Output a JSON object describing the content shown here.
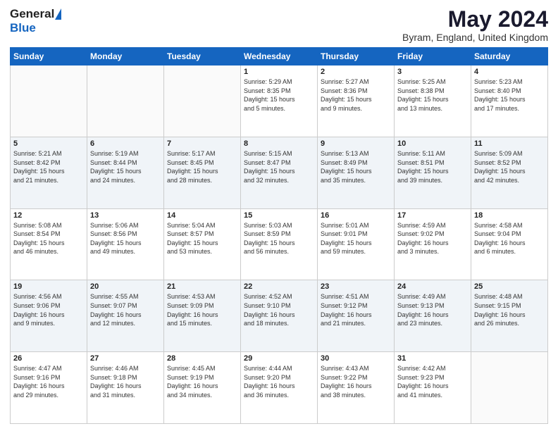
{
  "header": {
    "logo_general": "General",
    "logo_blue": "Blue",
    "month_title": "May 2024",
    "location": "Byram, England, United Kingdom"
  },
  "calendar": {
    "days_of_week": [
      "Sunday",
      "Monday",
      "Tuesday",
      "Wednesday",
      "Thursday",
      "Friday",
      "Saturday"
    ],
    "weeks": [
      [
        {
          "day": "",
          "info": ""
        },
        {
          "day": "",
          "info": ""
        },
        {
          "day": "",
          "info": ""
        },
        {
          "day": "1",
          "info": "Sunrise: 5:29 AM\nSunset: 8:35 PM\nDaylight: 15 hours\nand 5 minutes."
        },
        {
          "day": "2",
          "info": "Sunrise: 5:27 AM\nSunset: 8:36 PM\nDaylight: 15 hours\nand 9 minutes."
        },
        {
          "day": "3",
          "info": "Sunrise: 5:25 AM\nSunset: 8:38 PM\nDaylight: 15 hours\nand 13 minutes."
        },
        {
          "day": "4",
          "info": "Sunrise: 5:23 AM\nSunset: 8:40 PM\nDaylight: 15 hours\nand 17 minutes."
        }
      ],
      [
        {
          "day": "5",
          "info": "Sunrise: 5:21 AM\nSunset: 8:42 PM\nDaylight: 15 hours\nand 21 minutes."
        },
        {
          "day": "6",
          "info": "Sunrise: 5:19 AM\nSunset: 8:44 PM\nDaylight: 15 hours\nand 24 minutes."
        },
        {
          "day": "7",
          "info": "Sunrise: 5:17 AM\nSunset: 8:45 PM\nDaylight: 15 hours\nand 28 minutes."
        },
        {
          "day": "8",
          "info": "Sunrise: 5:15 AM\nSunset: 8:47 PM\nDaylight: 15 hours\nand 32 minutes."
        },
        {
          "day": "9",
          "info": "Sunrise: 5:13 AM\nSunset: 8:49 PM\nDaylight: 15 hours\nand 35 minutes."
        },
        {
          "day": "10",
          "info": "Sunrise: 5:11 AM\nSunset: 8:51 PM\nDaylight: 15 hours\nand 39 minutes."
        },
        {
          "day": "11",
          "info": "Sunrise: 5:09 AM\nSunset: 8:52 PM\nDaylight: 15 hours\nand 42 minutes."
        }
      ],
      [
        {
          "day": "12",
          "info": "Sunrise: 5:08 AM\nSunset: 8:54 PM\nDaylight: 15 hours\nand 46 minutes."
        },
        {
          "day": "13",
          "info": "Sunrise: 5:06 AM\nSunset: 8:56 PM\nDaylight: 15 hours\nand 49 minutes."
        },
        {
          "day": "14",
          "info": "Sunrise: 5:04 AM\nSunset: 8:57 PM\nDaylight: 15 hours\nand 53 minutes."
        },
        {
          "day": "15",
          "info": "Sunrise: 5:03 AM\nSunset: 8:59 PM\nDaylight: 15 hours\nand 56 minutes."
        },
        {
          "day": "16",
          "info": "Sunrise: 5:01 AM\nSunset: 9:01 PM\nDaylight: 15 hours\nand 59 minutes."
        },
        {
          "day": "17",
          "info": "Sunrise: 4:59 AM\nSunset: 9:02 PM\nDaylight: 16 hours\nand 3 minutes."
        },
        {
          "day": "18",
          "info": "Sunrise: 4:58 AM\nSunset: 9:04 PM\nDaylight: 16 hours\nand 6 minutes."
        }
      ],
      [
        {
          "day": "19",
          "info": "Sunrise: 4:56 AM\nSunset: 9:06 PM\nDaylight: 16 hours\nand 9 minutes."
        },
        {
          "day": "20",
          "info": "Sunrise: 4:55 AM\nSunset: 9:07 PM\nDaylight: 16 hours\nand 12 minutes."
        },
        {
          "day": "21",
          "info": "Sunrise: 4:53 AM\nSunset: 9:09 PM\nDaylight: 16 hours\nand 15 minutes."
        },
        {
          "day": "22",
          "info": "Sunrise: 4:52 AM\nSunset: 9:10 PM\nDaylight: 16 hours\nand 18 minutes."
        },
        {
          "day": "23",
          "info": "Sunrise: 4:51 AM\nSunset: 9:12 PM\nDaylight: 16 hours\nand 21 minutes."
        },
        {
          "day": "24",
          "info": "Sunrise: 4:49 AM\nSunset: 9:13 PM\nDaylight: 16 hours\nand 23 minutes."
        },
        {
          "day": "25",
          "info": "Sunrise: 4:48 AM\nSunset: 9:15 PM\nDaylight: 16 hours\nand 26 minutes."
        }
      ],
      [
        {
          "day": "26",
          "info": "Sunrise: 4:47 AM\nSunset: 9:16 PM\nDaylight: 16 hours\nand 29 minutes."
        },
        {
          "day": "27",
          "info": "Sunrise: 4:46 AM\nSunset: 9:18 PM\nDaylight: 16 hours\nand 31 minutes."
        },
        {
          "day": "28",
          "info": "Sunrise: 4:45 AM\nSunset: 9:19 PM\nDaylight: 16 hours\nand 34 minutes."
        },
        {
          "day": "29",
          "info": "Sunrise: 4:44 AM\nSunset: 9:20 PM\nDaylight: 16 hours\nand 36 minutes."
        },
        {
          "day": "30",
          "info": "Sunrise: 4:43 AM\nSunset: 9:22 PM\nDaylight: 16 hours\nand 38 minutes."
        },
        {
          "day": "31",
          "info": "Sunrise: 4:42 AM\nSunset: 9:23 PM\nDaylight: 16 hours\nand 41 minutes."
        },
        {
          "day": "",
          "info": ""
        }
      ]
    ]
  }
}
